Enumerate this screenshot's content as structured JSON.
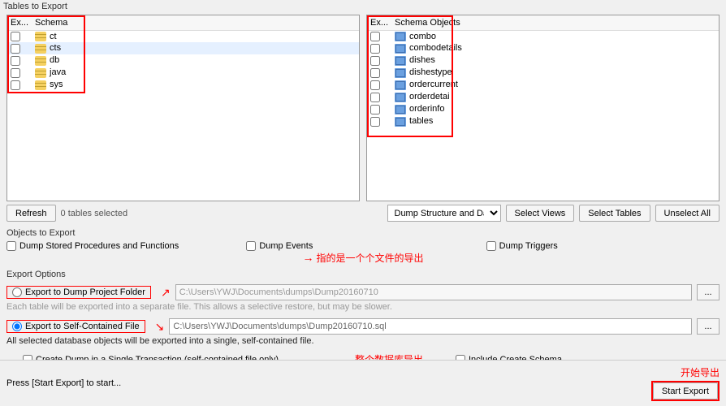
{
  "headers": {
    "tables_to_export": "Tables to Export",
    "left_col_exp": "Ex...",
    "left_col_schema": "Schema",
    "right_col_exp": "Ex...",
    "right_col_objects": "Schema Objects",
    "objects_to_export": "Objects to Export",
    "export_options": "Export Options"
  },
  "schemas": {
    "items": [
      {
        "name": "ct"
      },
      {
        "name": "cts"
      },
      {
        "name": "db"
      },
      {
        "name": "java"
      },
      {
        "name": "sys"
      }
    ]
  },
  "schema_objects": {
    "items": [
      {
        "name": "combo"
      },
      {
        "name": "combodetails"
      },
      {
        "name": "dishes"
      },
      {
        "name": "dishestype"
      },
      {
        "name": "ordercurrent"
      },
      {
        "name": "orderdetai"
      },
      {
        "name": "orderinfo"
      },
      {
        "name": "tables"
      }
    ]
  },
  "toolbar": {
    "refresh": "Refresh",
    "tables_selected": "0 tables selected",
    "dump_mode": "Dump Structure and Da",
    "select_views": "Select Views",
    "select_tables": "Select Tables",
    "unselect_all": "Unselect All"
  },
  "objects": {
    "dump_sp": "Dump Stored Procedures and Functions",
    "dump_events": "Dump Events",
    "dump_triggers": "Dump Triggers"
  },
  "options": {
    "project_folder": "Export to Dump Project Folder",
    "project_path": "C:\\Users\\YWJ\\Documents\\dumps\\Dump20160710",
    "project_note": "Each table will be exported into a separate file. This allows a selective restore, but may be slower.",
    "self_contained": "Export to Self-Contained File",
    "self_path": "C:\\Users\\YWJ\\Documents\\dumps\\Dump20160710.sql",
    "self_note": "All selected database objects will be exported into a single, self-contained file.",
    "single_tx": "Create Dump in a Single Transaction (self-contained file only)",
    "include_schema": "Include Create Schema",
    "browse": "..."
  },
  "annotations": {
    "per_file": "指的是一个个文件的导出",
    "whole_db": "整个数据库导出",
    "start": "开始导出"
  },
  "bottom": {
    "hint": "Press [Start Export] to start...",
    "start_export": "Start Export"
  }
}
